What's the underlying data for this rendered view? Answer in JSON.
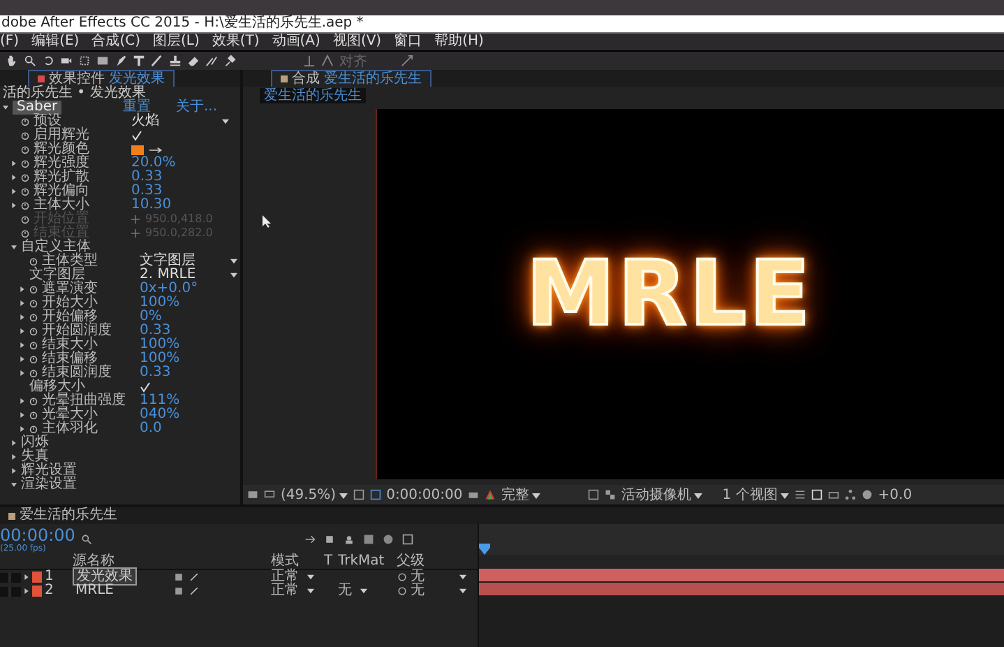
{
  "app": {
    "title": "dobe After Effects CC 2015 - H:\\爱生活的乐先生.aep *"
  },
  "menu": [
    "(F)",
    "编辑(E)",
    "合成(C)",
    "图层(L)",
    "效果(T)",
    "动画(A)",
    "视图(V)",
    "窗口",
    "帮助(H)"
  ],
  "toolbar": {
    "align_label": "对齐"
  },
  "effect_panel": {
    "tab_label": "效果控件",
    "tab_layer": "发光效果",
    "header": "活的乐先生 • 发光效果",
    "effect": {
      "label": "Saber",
      "reset": "重置",
      "about": "关于...",
      "expanded": true,
      "children": [
        {
          "kind": "dropdown",
          "label": "预设",
          "value": "火焰",
          "animatable": true
        },
        {
          "kind": "check",
          "label": "启用辉光",
          "checked": true,
          "animatable": true
        },
        {
          "kind": "color",
          "label": "辉光颜色",
          "color": "#f07f1a",
          "animatable": true
        },
        {
          "kind": "number",
          "label": "辉光强度",
          "value": "20.0%",
          "animatable": true,
          "expanded": false
        },
        {
          "kind": "number",
          "label": "辉光扩散",
          "value": "0.33",
          "animatable": true,
          "expanded": false
        },
        {
          "kind": "number",
          "label": "辉光偏向",
          "value": "0.33",
          "animatable": true,
          "expanded": false
        },
        {
          "kind": "number",
          "label": "主体大小",
          "value": "10.30",
          "animatable": true,
          "expanded": false
        },
        {
          "kind": "position",
          "label": "开始位置",
          "value": "950.0,418.0",
          "animatable": true,
          "disabled": true
        },
        {
          "kind": "position",
          "label": "结束位置",
          "value": "950.0,282.0",
          "animatable": true,
          "disabled": true
        },
        {
          "kind": "group",
          "label": "自定义主体",
          "expanded": true,
          "children": [
            {
              "kind": "dropdown",
              "label": "主体类型",
              "value": "文字图层",
              "animatable": true
            },
            {
              "kind": "dropdown",
              "label": "文字图层",
              "value": "2. MRLE",
              "animatable": false
            },
            {
              "kind": "number",
              "label": "遮罩演变",
              "value": "0x+0.0°",
              "animatable": true,
              "expanded": false
            },
            {
              "kind": "number",
              "label": "开始大小",
              "value": "100%",
              "animatable": true,
              "expanded": false
            },
            {
              "kind": "number",
              "label": "开始偏移",
              "value": "0%",
              "animatable": true,
              "expanded": false
            },
            {
              "kind": "number",
              "label": "开始圆润度",
              "value": "0.33",
              "animatable": true,
              "expanded": false
            },
            {
              "kind": "number",
              "label": "结束大小",
              "value": "100%",
              "animatable": true,
              "expanded": false
            },
            {
              "kind": "number",
              "label": "结束偏移",
              "value": "100%",
              "animatable": true,
              "expanded": false
            },
            {
              "kind": "number",
              "label": "结束圆润度",
              "value": "0.33",
              "animatable": true,
              "expanded": false
            },
            {
              "kind": "check",
              "label": "偏移大小",
              "checked": true,
              "animatable": false
            },
            {
              "kind": "number",
              "label": "光晕扭曲强度",
              "value": "111%",
              "animatable": true,
              "expanded": false
            },
            {
              "kind": "number",
              "label": "光晕大小",
              "value": "040%",
              "animatable": true,
              "expanded": false
            },
            {
              "kind": "number",
              "label": "主体羽化",
              "value": "0.0",
              "animatable": true,
              "expanded": false
            }
          ]
        },
        {
          "kind": "group",
          "label": "闪烁",
          "expanded": false
        },
        {
          "kind": "group",
          "label": "失真",
          "expanded": false
        },
        {
          "kind": "group",
          "label": "辉光设置",
          "expanded": false
        },
        {
          "kind": "group",
          "label": "渲染设置",
          "expanded": true
        }
      ]
    }
  },
  "viewer": {
    "tab_label": "合成",
    "tab_comp": "爱生活的乐先生",
    "breadcrumb": "爱生活的乐先生",
    "text": "MRLE",
    "zoom": "(49.5%)",
    "timecode": "0:00:00:00",
    "resolution": "完整",
    "camera": "活动摄像机",
    "views": "1 个视图",
    "exposure": "+0.0"
  },
  "timeline": {
    "tab": "爱生活的乐先生",
    "timecode": "00:00:00",
    "fps": "(25.00 fps)",
    "columns": {
      "name": "源名称",
      "mode": "模式",
      "t": "T",
      "trkmat": "TrkMat",
      "parent": "父级"
    },
    "layers": [
      {
        "index": "1",
        "name": "发光效果",
        "selected": true,
        "mode": "正常",
        "parent": "无"
      },
      {
        "index": "2",
        "name": "MRLE",
        "selected": false,
        "mode": "正常",
        "trkmat": "无",
        "parent": "无"
      }
    ]
  }
}
